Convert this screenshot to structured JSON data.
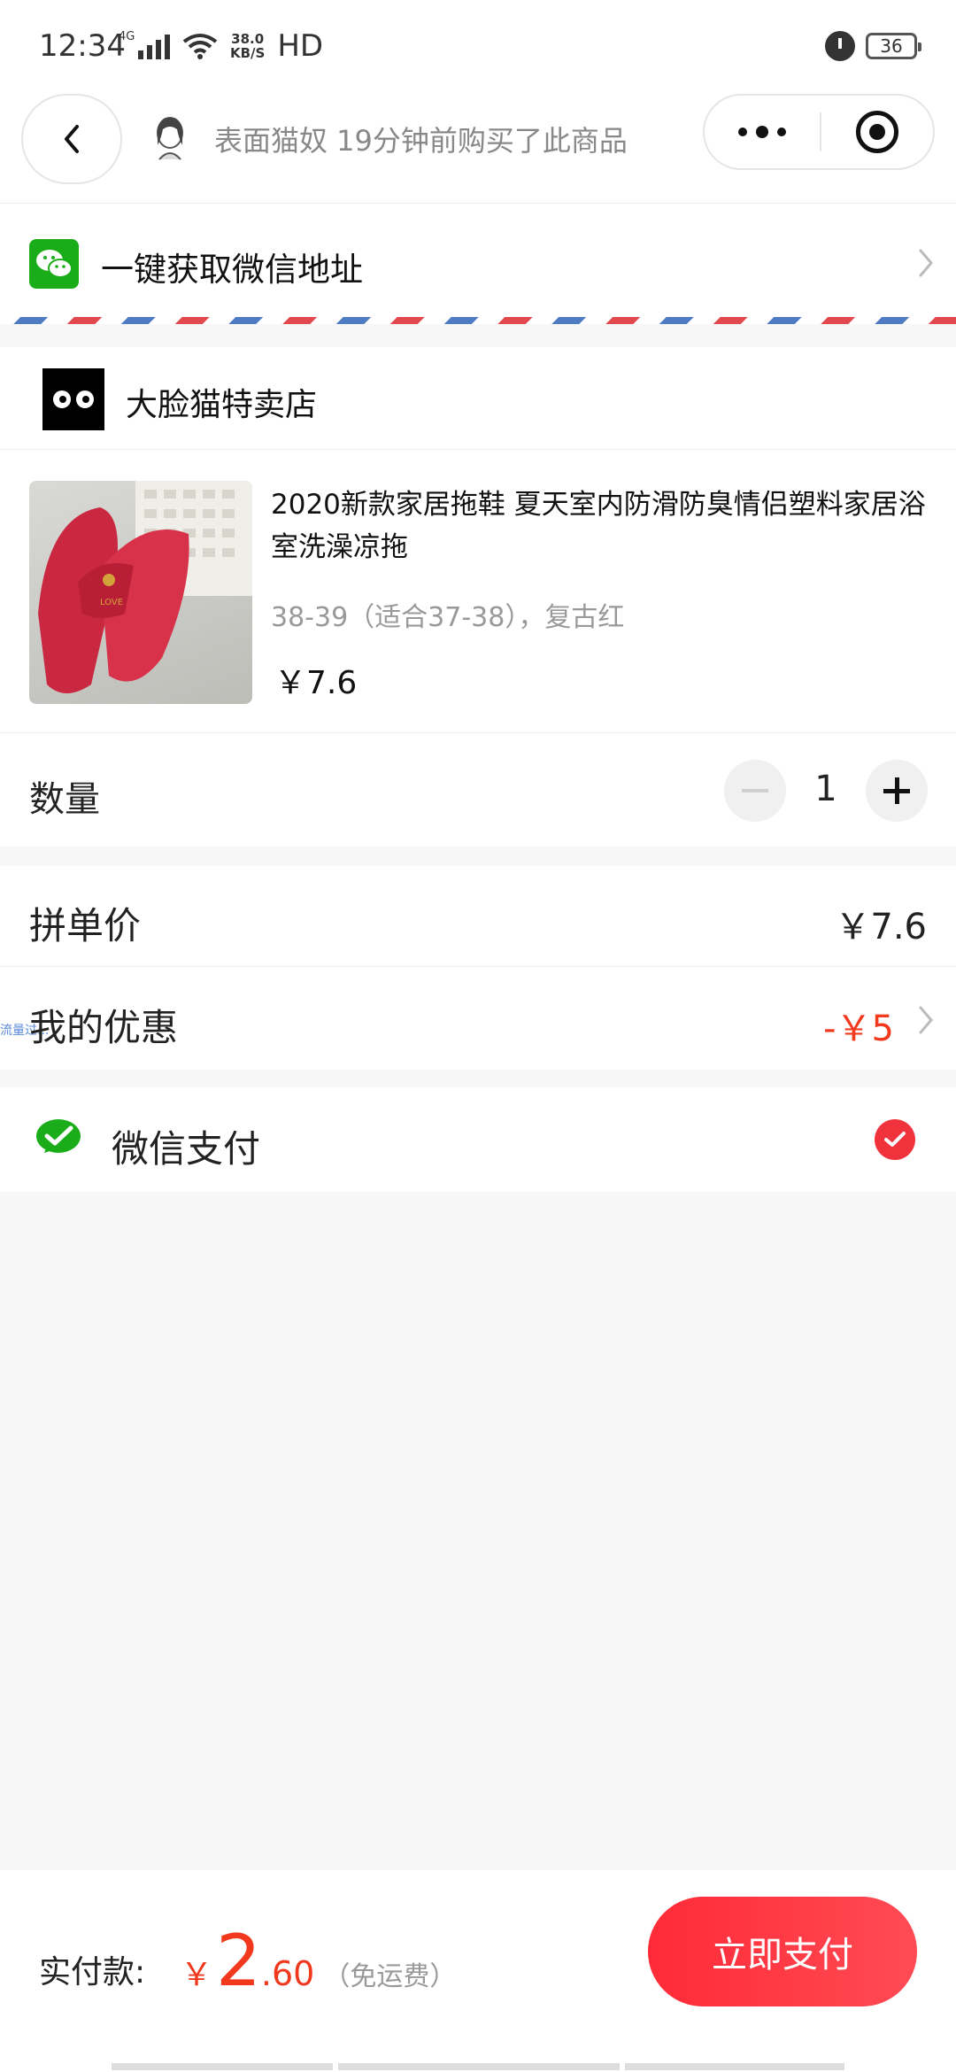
{
  "status_bar": {
    "time": "12:34",
    "network": "4G",
    "speed_value": "38.0",
    "speed_unit": "KB/S",
    "hd": "HD",
    "battery": "36"
  },
  "nav": {
    "buyer_message": "表面猫奴 19分钟前购买了此商品"
  },
  "address": {
    "label": "一键获取微信地址"
  },
  "shop": {
    "name": "大脸猫特卖店"
  },
  "product": {
    "title": "2020新款家居拖鞋 夏天室内防滑防臭情侣塑料家居浴室洗澡凉拖",
    "spec": "38-39（适合37-38），复古红",
    "price": "￥7.6",
    "image_text": "LOVE"
  },
  "quantity": {
    "label": "数量",
    "value": "1"
  },
  "pricing": {
    "group_price_label": "拼单价",
    "group_price_value": "￥7.6",
    "discount_label": "我的优惠",
    "discount_value": "-￥5",
    "side_note": "流量过..."
  },
  "payment": {
    "method_label": "微信支付"
  },
  "footer": {
    "total_label": "实付款:",
    "currency": "￥",
    "total_integer": "2",
    "total_decimal": ".60",
    "shipping_note": "（免运费）",
    "pay_button": "立即支付"
  },
  "colors": {
    "accent_red": "#f2391e",
    "button_red": "#ff2a37",
    "wechat_green": "#1aad19"
  }
}
